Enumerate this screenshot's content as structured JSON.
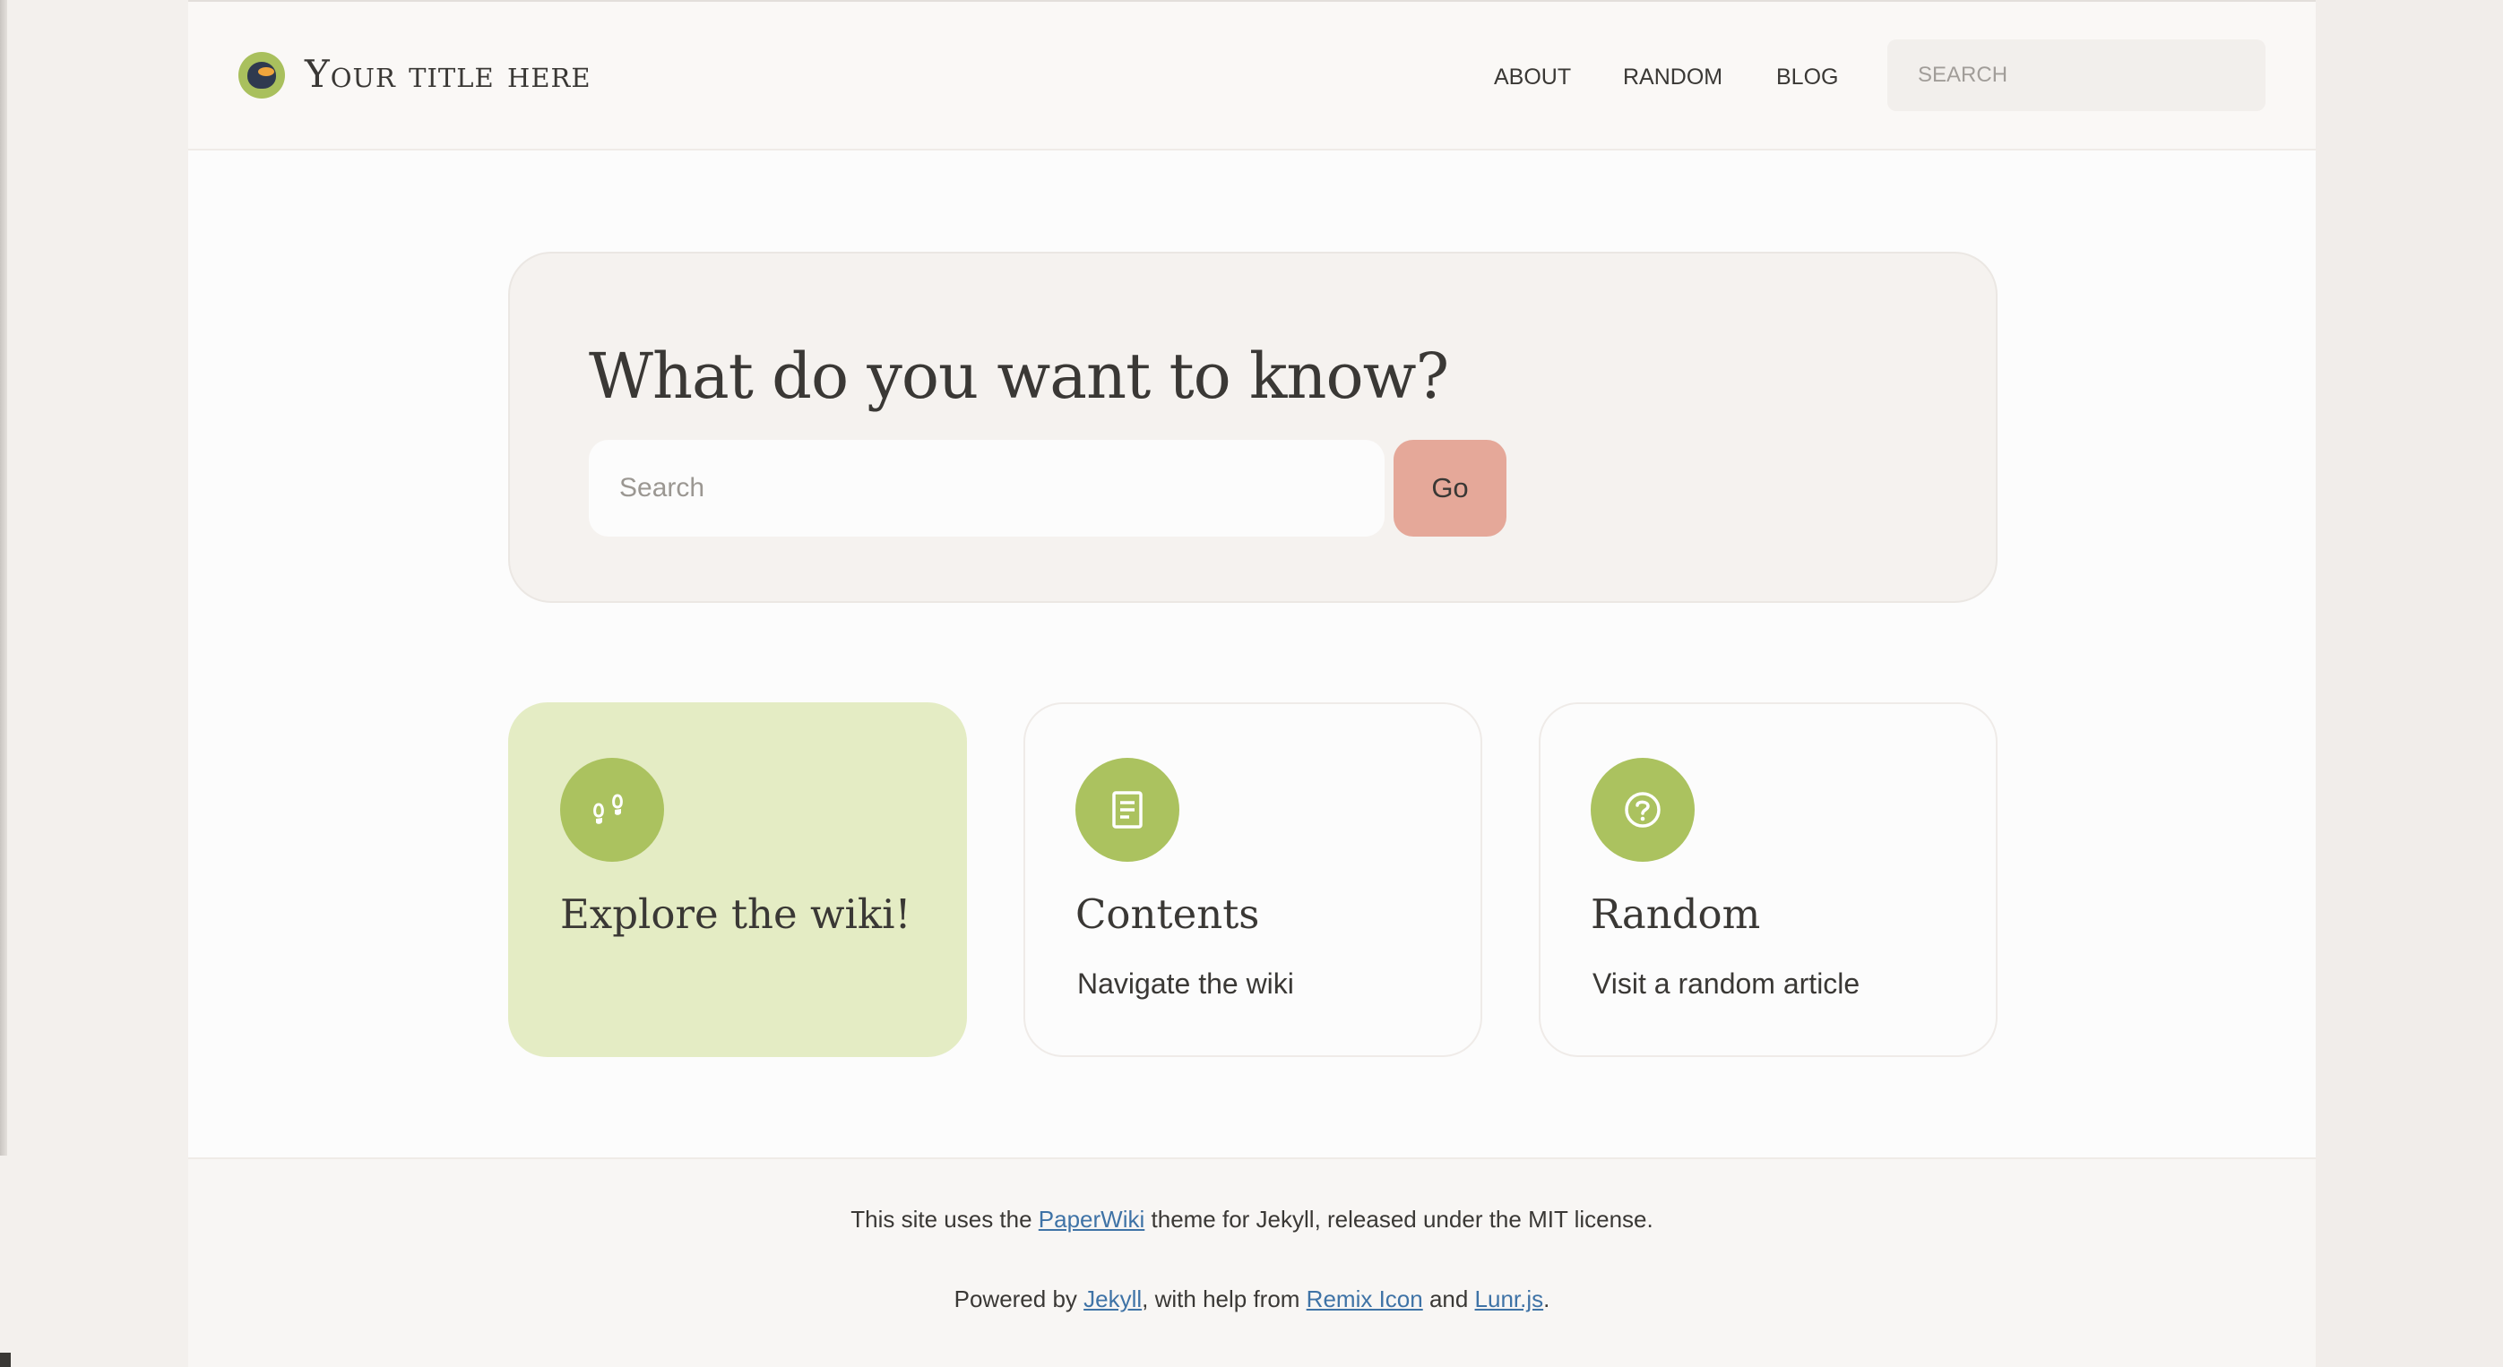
{
  "header": {
    "site_title": "Your title here",
    "nav": {
      "about": "ABOUT",
      "random": "RANDOM",
      "blog": "BLOG"
    },
    "search_placeholder": "SEARCH"
  },
  "hero": {
    "title": "What do you want to know?",
    "search_placeholder": "Search",
    "go_label": "Go"
  },
  "cards": [
    {
      "title": "Explore the wiki!",
      "subtitle": "",
      "icon": "footprint-icon"
    },
    {
      "title": "Contents",
      "subtitle": "Navigate the wiki",
      "icon": "file-list-icon"
    },
    {
      "title": "Random",
      "subtitle": "Visit a random article",
      "icon": "question-icon"
    }
  ],
  "footer": {
    "line1_before": "This site uses the ",
    "line1_link": "PaperWiki",
    "line1_after": " theme for Jekyll, released under the MIT license.",
    "line2_before": "Powered by ",
    "line2_link1": "Jekyll",
    "line2_mid1": ", with help from ",
    "line2_link2": "Remix Icon",
    "line2_mid2": " and ",
    "line2_link3": "Lunr.js",
    "line2_end": "."
  },
  "colors": {
    "accent_green": "#abc25f",
    "active_card": "#e4ecc4",
    "go_button": "#e5a899",
    "link": "#3f73a6"
  }
}
